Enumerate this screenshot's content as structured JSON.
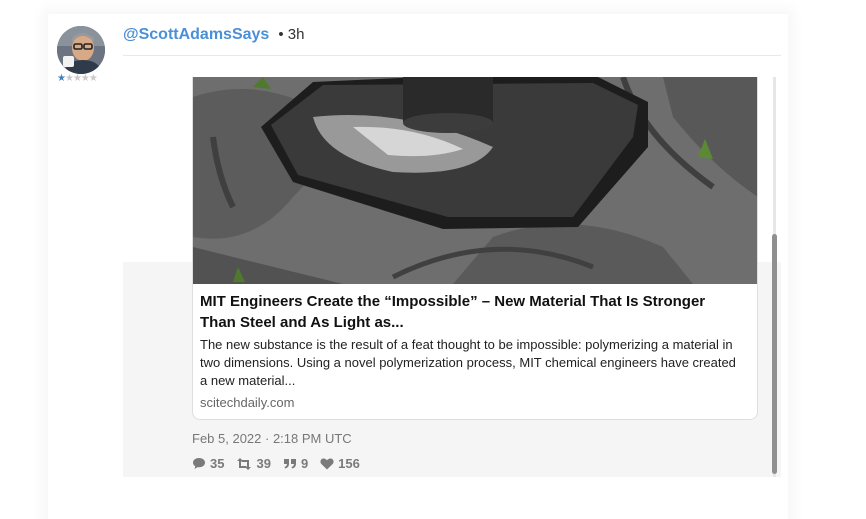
{
  "tweet": {
    "handle": "@ScottAdamsSays",
    "time": "• 3h",
    "rating": {
      "value": 1,
      "max": 5
    },
    "link_card": {
      "title": "MIT Engineers Create the “Impossible” – New Material That Is Stronger Than Steel and As Light as...",
      "description": "The new substance is the result of a feat thought to be impossible: polymerizing a material in two dimensions. Using a novel polymerization process, MIT chemical engineers have created a new material...",
      "domain": "scitechdaily.com"
    },
    "date": "Feb 5, 2022 · 2:18 PM UTC",
    "stats": {
      "replies": "35",
      "retweets": "39",
      "quotes": "9",
      "likes": "156"
    }
  },
  "colors": {
    "accent": "#4a90d9",
    "star_active": "#3b82c4",
    "icon_gray": "#7a7a7a"
  }
}
